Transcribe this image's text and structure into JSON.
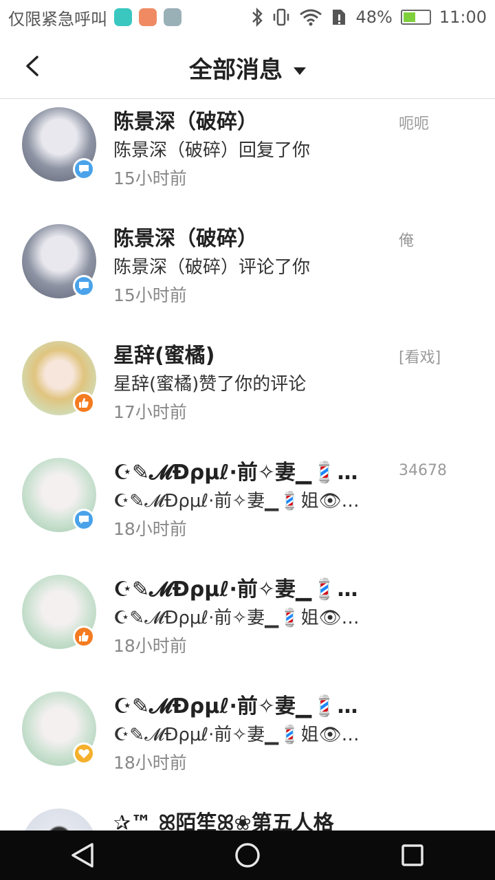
{
  "status": {
    "left_text": "仅限紧急呼叫",
    "battery": "48%",
    "battery_level": 0.48,
    "time": "11:00"
  },
  "header": {
    "title": "全部消息"
  },
  "messages": [
    {
      "name": "陈景深（破碎）",
      "text": "陈景深（破碎）回复了你",
      "time": "15小时前",
      "ref": "呃呃",
      "badge": "comment-icon"
    },
    {
      "name": "陈景深（破碎）",
      "text": "陈景深（破碎）评论了你",
      "time": "15小时前",
      "ref": "俺",
      "badge": "comment-icon"
    },
    {
      "name": "星辞(蜜橘)",
      "text": "星辞(蜜橘)赞了你的评论",
      "time": "17小时前",
      "ref": "[看戏]",
      "badge": "thumbs-up-icon"
    },
    {
      "name": "☪✎𝓜Ɖρμℓ·前✧妻▁💈姐...",
      "text": "☪✎𝓜Ɖρμℓ·前✧妻▁💈姐👁株式会社...",
      "time": "18小时前",
      "ref": "34678",
      "badge": "comment-icon"
    },
    {
      "name": "☪✎𝓜Ɖρμℓ·前✧妻▁💈姐...",
      "text": "☪✎𝓜Ɖρμℓ·前✧妻▁💈姐👁株式会社...",
      "time": "18小时前",
      "ref": "",
      "badge": "thumbs-up-icon"
    },
    {
      "name": "☪✎𝓜Ɖρμℓ·前✧妻▁💈姐...",
      "text": "☪✎𝓜Ɖρμℓ·前✧妻▁💈姐👁株式会社...",
      "time": "18小时前",
      "ref": "",
      "badge": "heart-icon"
    },
    {
      "name": "✰™ ꕤ陌笙ꕤ❀第五人格",
      "text": "",
      "time": "",
      "ref": "",
      "badge": ""
    }
  ]
}
